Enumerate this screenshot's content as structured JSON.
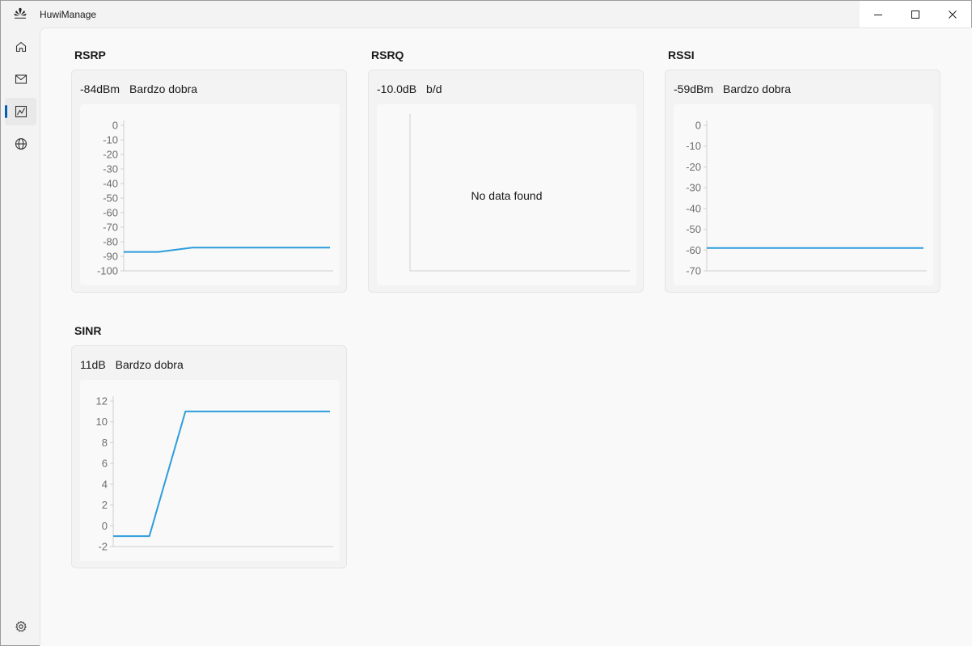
{
  "window": {
    "title": "HuwiManage",
    "controls": {
      "minimize": "—",
      "maximize": "☐",
      "close": "✕"
    }
  },
  "sidebar": {
    "items": [
      {
        "name": "home",
        "icon": "home-icon",
        "active": false
      },
      {
        "name": "messages",
        "icon": "mail-icon",
        "active": false
      },
      {
        "name": "signal",
        "icon": "chart-icon",
        "active": true
      },
      {
        "name": "network",
        "icon": "globe-icon",
        "active": false
      }
    ],
    "settings_icon": "gear-icon"
  },
  "accent_color": "#2d9cdb",
  "cards": {
    "rsrp": {
      "title": "RSRP",
      "value": "-84dBm",
      "quality": "Bardzo dobra"
    },
    "rsrq": {
      "title": "RSRQ",
      "value": "-10.0dB",
      "quality": "b/d",
      "empty_message": "No data found"
    },
    "rssi": {
      "title": "RSSI",
      "value": "-59dBm",
      "quality": "Bardzo dobra"
    },
    "sinr": {
      "title": "SINR",
      "value": "11dB",
      "quality": "Bardzo dobra"
    }
  },
  "chart_data": [
    {
      "type": "line",
      "ylim": [
        -100,
        0
      ],
      "yticks": [
        0,
        -10,
        -20,
        -30,
        -40,
        -50,
        -60,
        -70,
        -80,
        -90,
        -100
      ],
      "series": [
        {
          "values": [
            -87,
            -87,
            -84,
            -84,
            -84,
            -84,
            -84
          ]
        }
      ]
    },
    {
      "type": "line",
      "series": []
    },
    {
      "type": "line",
      "ylim": [
        -70,
        0
      ],
      "yticks": [
        0,
        -10,
        -20,
        -30,
        -40,
        -50,
        -60,
        -70
      ],
      "series": [
        {
          "values": [
            -59,
            -59,
            -59,
            -59,
            -59,
            -59,
            -59
          ]
        }
      ]
    },
    {
      "type": "line",
      "ylim": [
        -2,
        12
      ],
      "yticks": [
        12,
        10,
        8,
        6,
        4,
        2,
        0,
        -2
      ],
      "series": [
        {
          "values": [
            -1,
            -1,
            11,
            11,
            11,
            11,
            11
          ]
        }
      ]
    }
  ]
}
